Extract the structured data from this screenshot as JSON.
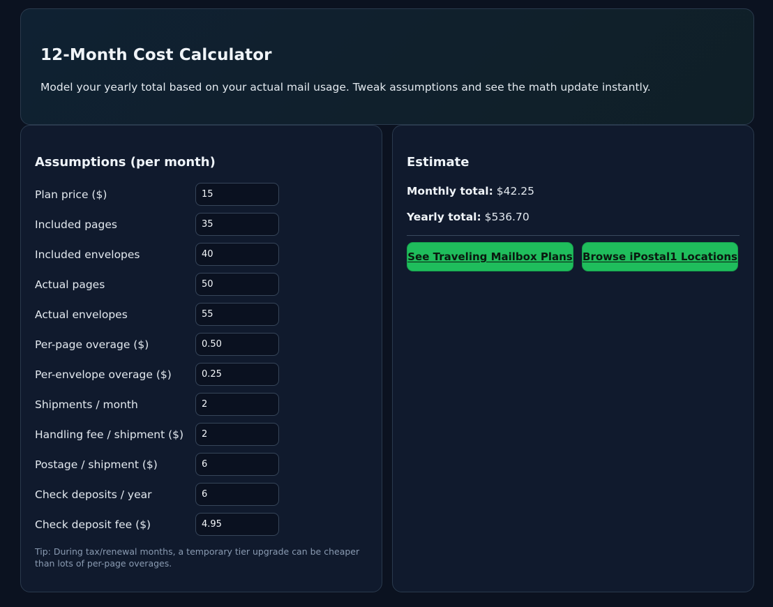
{
  "header": {
    "title": "12-Month Cost Calculator",
    "description": "Model your yearly total based on your actual mail usage. Tweak assumptions and see the math update instantly."
  },
  "assumptions": {
    "title": "Assumptions (per month)",
    "fields": [
      {
        "label": "Plan price ($)",
        "value": "15"
      },
      {
        "label": "Included pages",
        "value": "35"
      },
      {
        "label": "Included envelopes",
        "value": "40"
      },
      {
        "label": "Actual pages",
        "value": "50"
      },
      {
        "label": "Actual envelopes",
        "value": "55"
      },
      {
        "label": "Per-page overage ($)",
        "value": "0.50"
      },
      {
        "label": "Per-envelope overage ($)",
        "value": "0.25"
      },
      {
        "label": "Shipments / month",
        "value": "2"
      },
      {
        "label": "Handling fee / shipment ($)",
        "value": "2"
      },
      {
        "label": "Postage / shipment ($)",
        "value": "6"
      },
      {
        "label": "Check deposits / year",
        "value": "6"
      },
      {
        "label": "Check deposit fee ($)",
        "value": "4.95"
      }
    ],
    "tip": "Tip: During tax/renewal months, a temporary tier upgrade can be cheaper than lots of per-page overages."
  },
  "estimate": {
    "title": "Estimate",
    "monthly_label": "Monthly total:",
    "monthly_value": "$42.25",
    "yearly_label": "Yearly total:",
    "yearly_value": "$536.70",
    "buttons": {
      "plans": "See Traveling Mailbox Plans",
      "locations": "Browse iPostal1 Locations"
    }
  },
  "colors": {
    "background": "#0b1220",
    "card": "#101a2d",
    "accent_green": "#1fbd5c"
  }
}
